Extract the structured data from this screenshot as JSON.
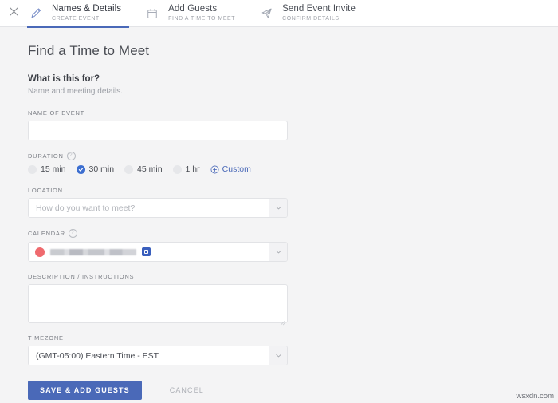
{
  "topnav": {
    "close_icon": "close-icon",
    "steps": [
      {
        "icon": "pencil-icon",
        "title": "Names & Details",
        "sub": "CREATE EVENT",
        "active": true
      },
      {
        "icon": "calendar-icon",
        "title": "Add Guests",
        "sub": "FIND A TIME TO MEET",
        "active": false
      },
      {
        "icon": "paper-plane-icon",
        "title": "Send Event Invite",
        "sub": "CONFIRM DETAILS",
        "active": false
      }
    ]
  },
  "page": {
    "title": "Find a Time to Meet",
    "section_title": "What is this for?",
    "section_sub": "Name and meeting details."
  },
  "form": {
    "name_of_event": {
      "label": "NAME OF EVENT",
      "value": "",
      "placeholder": ""
    },
    "duration": {
      "label": "DURATION",
      "help_icon": "help-icon",
      "options": [
        {
          "label": "15 min",
          "selected": false
        },
        {
          "label": "30 min",
          "selected": true
        },
        {
          "label": "45 min",
          "selected": false
        },
        {
          "label": "1 hr",
          "selected": false
        }
      ],
      "custom_label": "Custom",
      "custom_icon": "plus-circle-icon"
    },
    "location": {
      "label": "LOCATION",
      "value": "",
      "placeholder": "How do you want to meet?",
      "chevron_icon": "chevron-down-icon"
    },
    "calendar": {
      "label": "CALENDAR",
      "help_icon": "help-icon",
      "swatch_color": "#ef6a6e",
      "account_name": "",
      "badge_icon": "calendar-badge-icon",
      "chevron_icon": "chevron-down-icon"
    },
    "description": {
      "label": "DESCRIPTION / INSTRUCTIONS",
      "value": "",
      "placeholder": ""
    },
    "timezone": {
      "label": "TIMEZONE",
      "value": "(GMT-05:00) Eastern Time - EST",
      "chevron_icon": "chevron-down-icon"
    }
  },
  "actions": {
    "save_label": "SAVE & ADD GUESTS",
    "cancel_label": "CANCEL"
  },
  "watermark": "wsxdn.com",
  "colors": {
    "accent_blue": "#4a69b8",
    "radio_blue": "#3c6ed0",
    "swatch_red": "#ef6a6e",
    "page_bg": "#f4f4f5",
    "panel_white": "#ffffff"
  }
}
